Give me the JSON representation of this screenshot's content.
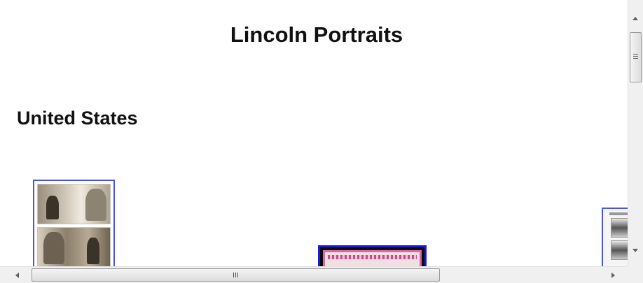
{
  "page": {
    "title": "Lincoln Portraits",
    "section_heading": "United States"
  },
  "thumbnails": [
    {
      "name": "stamp-pair",
      "border_color": "#4a55e0"
    },
    {
      "name": "pink-frame",
      "border_color": "#1d1bd8"
    },
    {
      "name": "photo-sheet",
      "border_color": "#4a55e0"
    }
  ],
  "scrollbars": {
    "vertical": {
      "position_fraction": 0.0
    },
    "horizontal": {
      "position_fraction": 0.0
    }
  },
  "colors": {
    "background": "#ffffff",
    "scrollbar_track": "#f0f0f0",
    "link_border": "#4a55e0"
  }
}
